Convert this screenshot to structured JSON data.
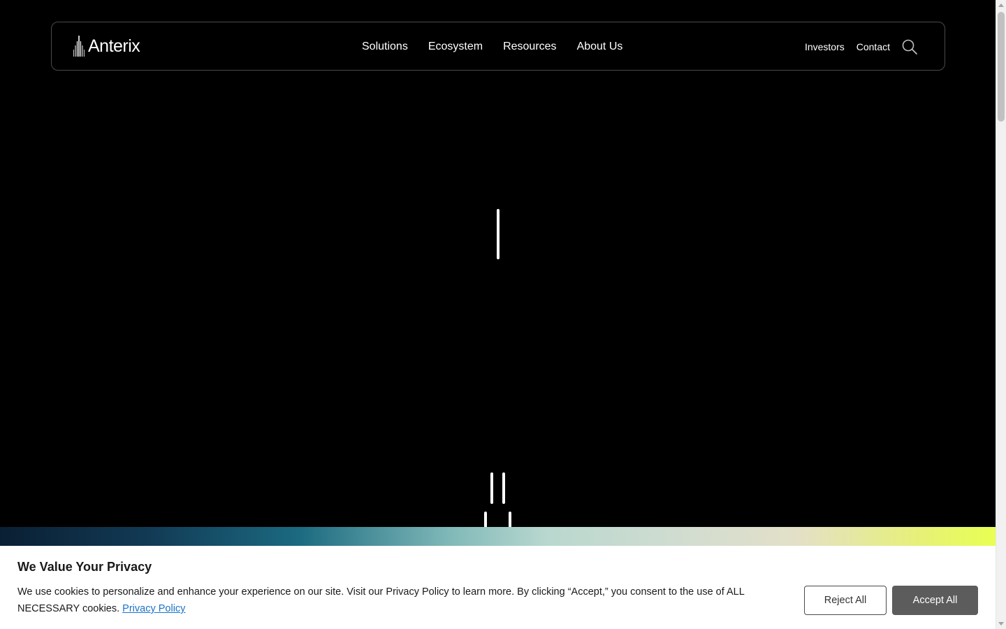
{
  "header": {
    "logo_text": "Anterix",
    "nav_main": [
      "Solutions",
      "Ecosystem",
      "Resources",
      "About Us"
    ],
    "nav_secondary": [
      "Investors",
      "Contact"
    ],
    "search_icon": "search-icon"
  },
  "cookie_banner": {
    "title": "We Value Your Privacy",
    "text": "We use cookies to personalize and enhance your experience on our site. Visit our Privacy Policy to learn more. By clicking “Accept,” you consent to the use of ALL NECESSARY cookies.",
    "link": "Privacy Policy",
    "reject_label": "Reject All",
    "accept_label": "Accept All"
  },
  "colors": {
    "background": "#000000",
    "accept_button": "#5c5c5c",
    "link": "#1a73c7"
  }
}
